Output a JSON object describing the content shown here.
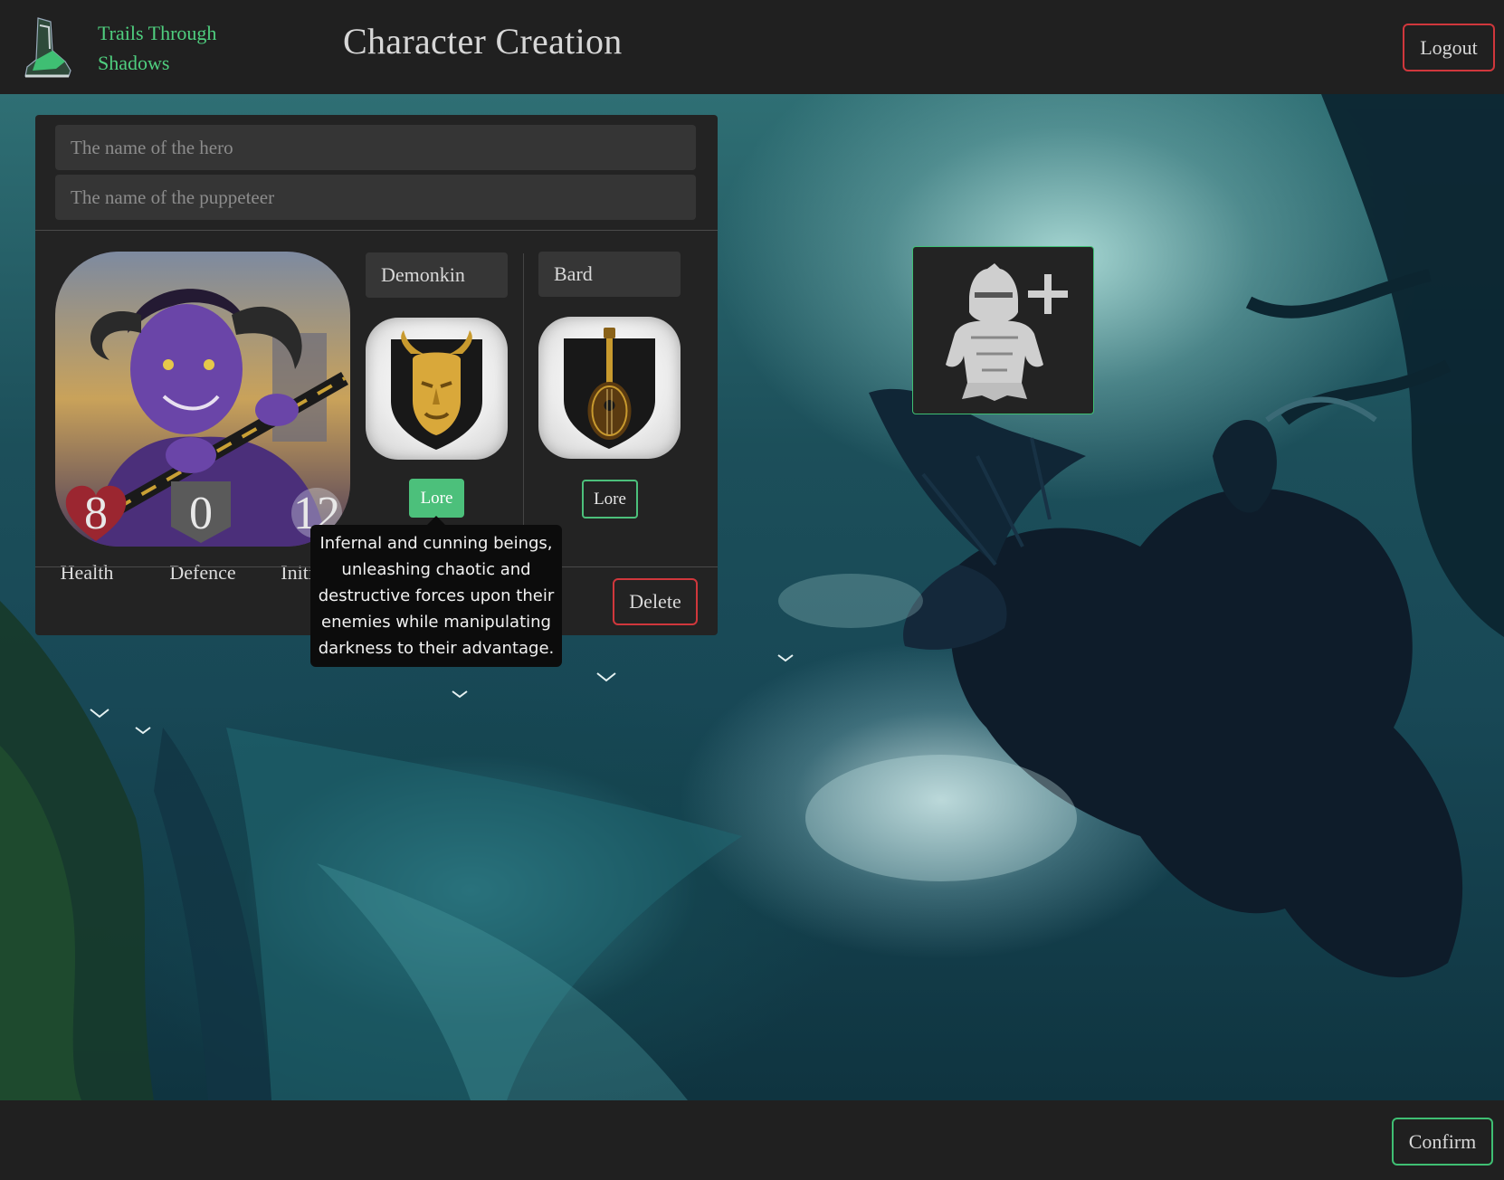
{
  "header": {
    "brand_line1": "Trails Through",
    "brand_line2": "Shadows",
    "title": "Character Creation",
    "logout_label": "Logout"
  },
  "character": {
    "hero_name": {
      "value": "",
      "placeholder": "The name of the hero"
    },
    "puppeteer_name": {
      "value": "",
      "placeholder": "The name of the puppeteer"
    },
    "stats": [
      {
        "value": "8",
        "label": "Health"
      },
      {
        "value": "0",
        "label": "Defence"
      },
      {
        "value": "12",
        "label": "Initiative"
      }
    ],
    "race": {
      "selected": "Demonkin",
      "lore_label": "Lore",
      "lore_active": true
    },
    "class": {
      "selected": "Bard",
      "lore_label": "Lore",
      "lore_active": false
    },
    "tooltip": "Infernal and cunning beings, unleashing chaotic and destructive forces upon their enemies while manipulating darkness to their advantage.",
    "delete_label": "Delete"
  },
  "add_hero": {
    "icon": "add-hero-icon"
  },
  "footer": {
    "confirm_label": "Confirm"
  },
  "colors": {
    "accent_green": "#4cc07b",
    "danger_red": "#d0373c",
    "brand_green": "#4fcf7f",
    "panel_bg": "#232323",
    "header_bg": "#202020"
  }
}
